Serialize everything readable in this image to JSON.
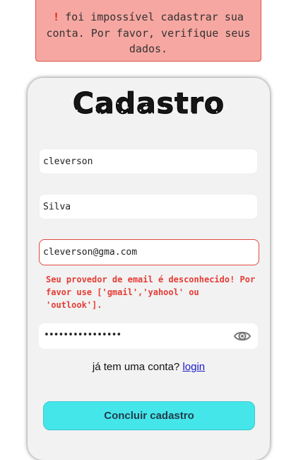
{
  "alert": {
    "icon": "!",
    "message": "foi impossível cadastrar sua conta. Por favor, verifique seus dados."
  },
  "form": {
    "title": "Cadastro",
    "first_name": "cleverson",
    "last_name": "Silva",
    "email": "cleverson@gma.com",
    "email_error": "Seu provedor de email é desconhecido! Por favor use ['gmail','yahool' ou 'outlook'].",
    "password_masked": "••••••••••••••••",
    "password_toggle_icon": "eye-icon",
    "login_prompt": "já tem uma conta?",
    "login_link": "login",
    "submit_label": "Concluir cadastro"
  },
  "colors": {
    "alert_bg": "#f7a7a1",
    "alert_border": "#d8574c",
    "error_text": "#e53c35",
    "submit_bg": "#45e6ea",
    "link": "#1a1acc"
  }
}
